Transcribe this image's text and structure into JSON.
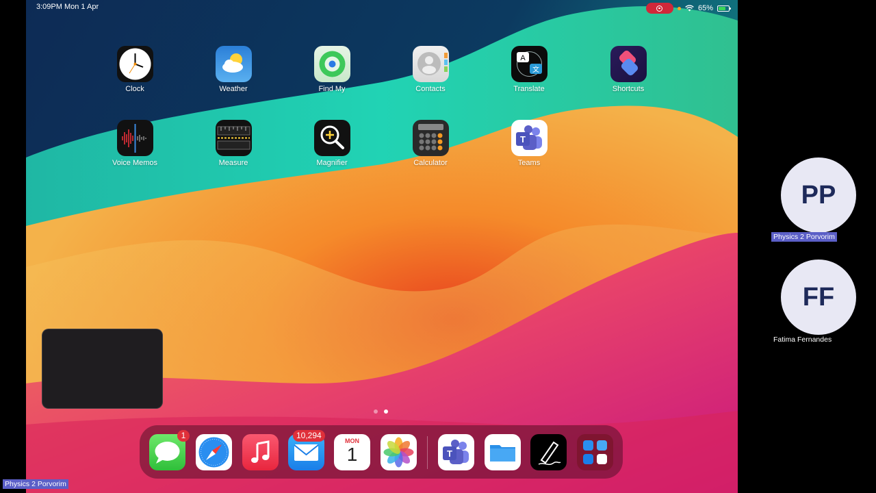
{
  "status": {
    "time": "3:09PM  Mon 1 Apr",
    "battery": "65%"
  },
  "home_apps": [
    {
      "label": "Clock"
    },
    {
      "label": "Weather"
    },
    {
      "label": "Find My"
    },
    {
      "label": "Contacts"
    },
    {
      "label": "Translate"
    },
    {
      "label": "Shortcuts"
    },
    {
      "label": "Voice Memos"
    },
    {
      "label": "Measure"
    },
    {
      "label": "Magnifier"
    },
    {
      "label": "Calculator"
    },
    {
      "label": "Teams"
    }
  ],
  "dock": {
    "messages_badge": "1",
    "mail_badge": "10,294",
    "calendar_day": "MON",
    "calendar_date": "1"
  },
  "translate_glyphs": {
    "a": "A",
    "b": "文"
  },
  "participants": [
    {
      "initials": "PP",
      "name": "Physics 2 Porvorim"
    },
    {
      "initials": "FF",
      "name": "Fatima Fernandes"
    }
  ],
  "self_label": "Physics 2 Porvorim",
  "colors": {
    "teams_purple": "#5b5fc7",
    "recording_red": "#d0283a",
    "badge_red": "#e0303a"
  }
}
